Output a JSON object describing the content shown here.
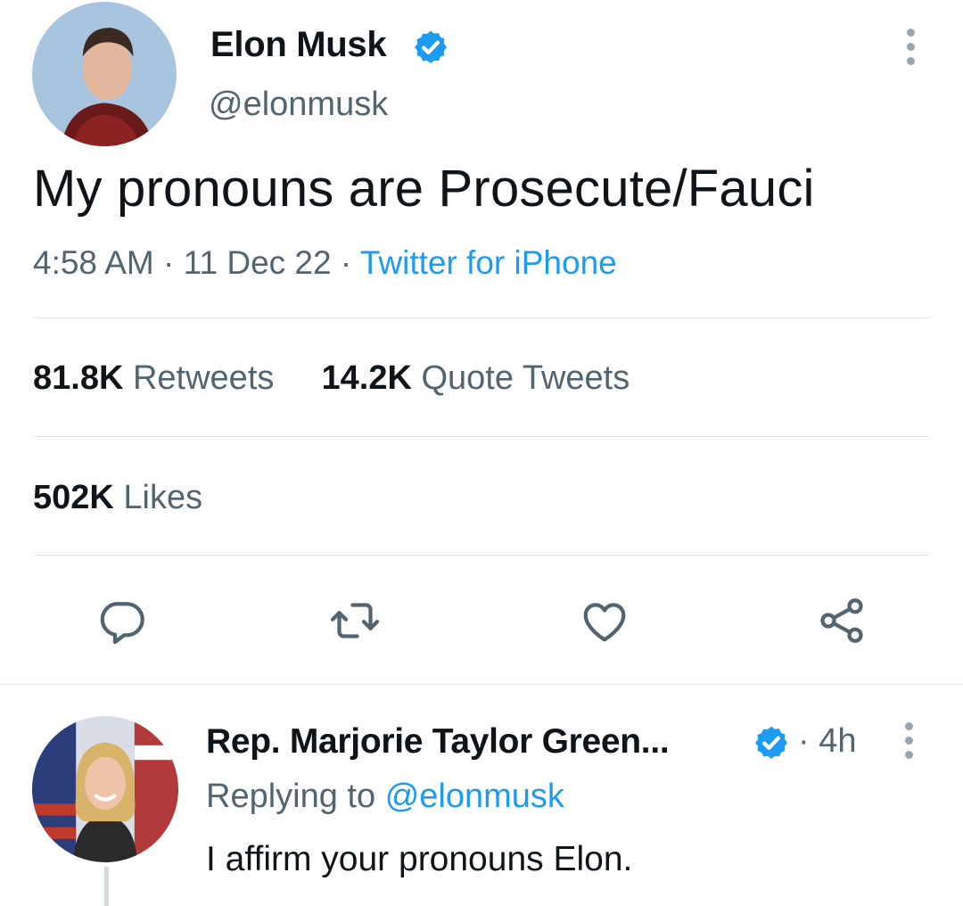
{
  "tweet": {
    "author_name": "Elon Musk",
    "author_handle": "@elonmusk",
    "text": "My pronouns are Prosecute/Fauci",
    "time": "4:58 AM",
    "date": "11 Dec 22",
    "sep": "·",
    "source": "Twitter for iPhone",
    "stats": {
      "retweets_count": "81.8K",
      "retweets_label": "Retweets",
      "quotes_count": "14.2K",
      "quotes_label": "Quote Tweets",
      "likes_count": "502K",
      "likes_label": "Likes"
    },
    "actions": [
      {
        "icon": "reply-icon"
      },
      {
        "icon": "retweet-icon"
      },
      {
        "icon": "like-icon"
      },
      {
        "icon": "share-icon"
      }
    ]
  },
  "reply": {
    "author_name": "Rep. Marjorie Taylor Green...",
    "time": "· 4h",
    "replying_prefix": "Replying to",
    "replying_handle": "@elonmusk",
    "text": "I affirm your pronouns Elon."
  },
  "colors": {
    "link": "#1d9bf0",
    "muted": "#536471",
    "text": "#0f1419",
    "verified": "#1d9bf0"
  }
}
